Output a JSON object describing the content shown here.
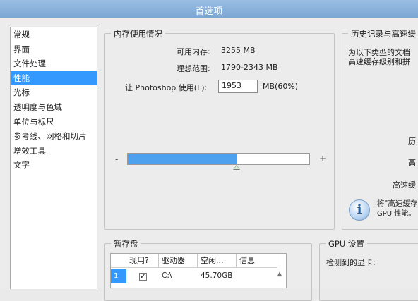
{
  "window": {
    "title": "首选项"
  },
  "sidebar": {
    "items": [
      {
        "label": "常规",
        "selected": false
      },
      {
        "label": "界面",
        "selected": false
      },
      {
        "label": "文件处理",
        "selected": false
      },
      {
        "label": "性能",
        "selected": true
      },
      {
        "label": "光标",
        "selected": false
      },
      {
        "label": "透明度与色域",
        "selected": false
      },
      {
        "label": "单位与标尺",
        "selected": false
      },
      {
        "label": "参考线、网格和切片",
        "selected": false
      },
      {
        "label": "增效工具",
        "selected": false
      },
      {
        "label": "文字",
        "selected": false
      }
    ]
  },
  "memory": {
    "legend": "内存使用情况",
    "available_label": "可用内存:",
    "available_value": "3255 MB",
    "ideal_label": "理想范围:",
    "ideal_value": "1790-2343 MB",
    "let_label": "让 Photoshop 使用(L):",
    "let_value": "1953",
    "let_suffix": "MB(60%)",
    "minus": "-",
    "plus": "+",
    "slider_percent": 60
  },
  "history": {
    "legend": "历史记录与高速缓",
    "desc_line1": "为以下类型的文档",
    "desc_line2": "高速缓存级别和拼",
    "row1": "历",
    "row2": "高",
    "row3": "高速缓",
    "note_line1": "将\"高速缓存",
    "note_line2": "GPU 性能。"
  },
  "scratch": {
    "legend": "暂存盘",
    "columns": [
      "现用?",
      "驱动器",
      "空闲...",
      "信息"
    ],
    "rows": [
      {
        "num": "1",
        "active": "✓",
        "drive": "C:\\",
        "free": "45.70GB",
        "info": ""
      }
    ]
  },
  "gpu": {
    "legend": "GPU 设置",
    "detected_label": "检测到的显卡:"
  }
}
